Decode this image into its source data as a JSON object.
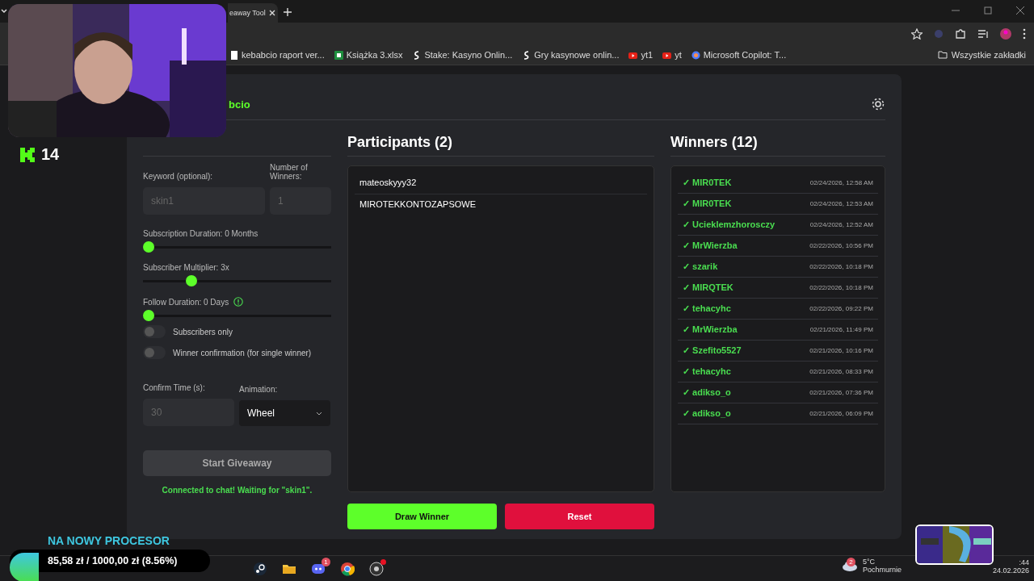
{
  "browser": {
    "tab_title": "eaway Tool",
    "bookmarks": [
      {
        "label": "kebabcio raport ver...",
        "kind": "doc"
      },
      {
        "label": "Książka 3.xlsx",
        "kind": "sheet"
      },
      {
        "label": "Stake: Kasyno Onlin...",
        "kind": "stake"
      },
      {
        "label": "Gry kasynowe onlin...",
        "kind": "stake"
      },
      {
        "label": "yt1",
        "kind": "yt"
      },
      {
        "label": "yt",
        "kind": "yt"
      },
      {
        "label": "Microsoft Copilot: T...",
        "kind": "copilot"
      }
    ],
    "all_bookmarks": "Wszystkie zakładki"
  },
  "viewer_count": "14",
  "app": {
    "title": "bcio",
    "settings": {
      "keyword": {
        "label": "Keyword (optional):",
        "placeholder": "skin1"
      },
      "winners_count": {
        "label": "Number of Winners:",
        "placeholder": "1"
      },
      "sliders": [
        {
          "label": "Subscription Duration: 0 Months",
          "level": 0,
          "info": false
        },
        {
          "label": "Subscriber Multiplier: 3x",
          "level": 0.24,
          "info": false
        },
        {
          "label": "Follow Duration: 0 Days",
          "level": 0,
          "info": true
        }
      ],
      "toggles": [
        {
          "label": "Subscribers only",
          "on": false
        },
        {
          "label": "Winner confirmation (for single winner)",
          "on": false
        }
      ],
      "confirm_time": {
        "label": "Confirm Time (s):",
        "placeholder": "30"
      },
      "animation": {
        "label": "Animation:",
        "value": "Wheel"
      },
      "start_button": "Start Giveaway",
      "status": "Connected to chat! Waiting for \"skin1\"."
    },
    "participants": {
      "title": "Participants (2)",
      "items": [
        "mateoskyyy32",
        "MIROTEKKONTOZAPSOWE"
      ]
    },
    "draw_button": "Draw Winner",
    "reset_button": "Reset",
    "winners": {
      "title": "Winners (12)",
      "items": [
        {
          "name": "✓ MIR0TEK",
          "time": "02/24/2026, 12:58 AM"
        },
        {
          "name": "✓ MIR0TEK",
          "time": "02/24/2026, 12:53 AM"
        },
        {
          "name": "✓ Ucieklemzhorosczy",
          "time": "02/24/2026, 12:52 AM"
        },
        {
          "name": "✓ MrWierzba",
          "time": "02/22/2026, 10:56 PM"
        },
        {
          "name": "✓ szarik",
          "time": "02/22/2026, 10:18 PM"
        },
        {
          "name": "✓ MIRQTEK",
          "time": "02/22/2026, 10:18 PM"
        },
        {
          "name": "✓ tehacyhc",
          "time": "02/22/2026, 09:22 PM"
        },
        {
          "name": "✓ MrWierzba",
          "time": "02/21/2026, 11:49 PM"
        },
        {
          "name": "✓ Szefito5527",
          "time": "02/21/2026, 10:16 PM"
        },
        {
          "name": "✓ tehacyhc",
          "time": "02/21/2026, 08:33 PM"
        },
        {
          "name": "✓ adikso_o",
          "time": "02/21/2026, 07:36 PM"
        },
        {
          "name": "✓ adikso_o",
          "time": "02/21/2026, 06:09 PM"
        }
      ]
    }
  },
  "goal": {
    "title": "NA NOWY PROCESOR",
    "progress": "85,58 zł / 1000,00 zł (8.56%)"
  },
  "taskbar": {
    "apps": [
      {
        "kind": "steam"
      },
      {
        "kind": "folder"
      },
      {
        "kind": "discord",
        "badge": "1"
      },
      {
        "kind": "chrome"
      },
      {
        "kind": "obs",
        "alert": true
      }
    ],
    "weather": {
      "badge": "2",
      "temp": "5°C",
      "condition": "Pochmurnie"
    },
    "clock": {
      "time": ":44",
      "date": "24.02.2026"
    }
  }
}
